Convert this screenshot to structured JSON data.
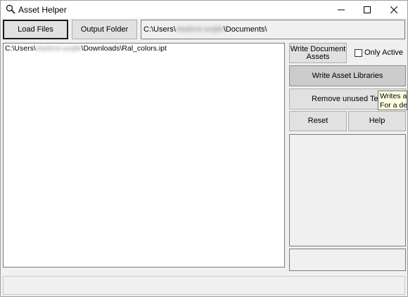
{
  "window": {
    "title": "Asset Helper",
    "icon": "magnifier-icon"
  },
  "toolbar": {
    "load_files_label": "Load Files",
    "output_folder_label": "Output Folder",
    "output_path_prefix": "C:\\Users\\",
    "output_path_user": "vladimir.wojtik",
    "output_path_suffix": "\\Documents\\"
  },
  "file_list": {
    "items": [
      {
        "prefix": "C:\\Users\\",
        "user": "vladimir.wojtik",
        "suffix": "\\Downloads\\Ral_colors.ipt"
      }
    ]
  },
  "actions": {
    "write_document_assets_line1": "Write Document",
    "write_document_assets_line2": "Assets",
    "only_active_label": "Only Active",
    "only_active_checked": false,
    "write_asset_libraries_label": "Write Asset Libraries",
    "remove_unused_textures_label": "Remove unused Textur",
    "reset_label": "Reset",
    "help_label": "Help"
  },
  "tooltip": {
    "line1": "Writes all",
    "line2": "For a defin"
  }
}
